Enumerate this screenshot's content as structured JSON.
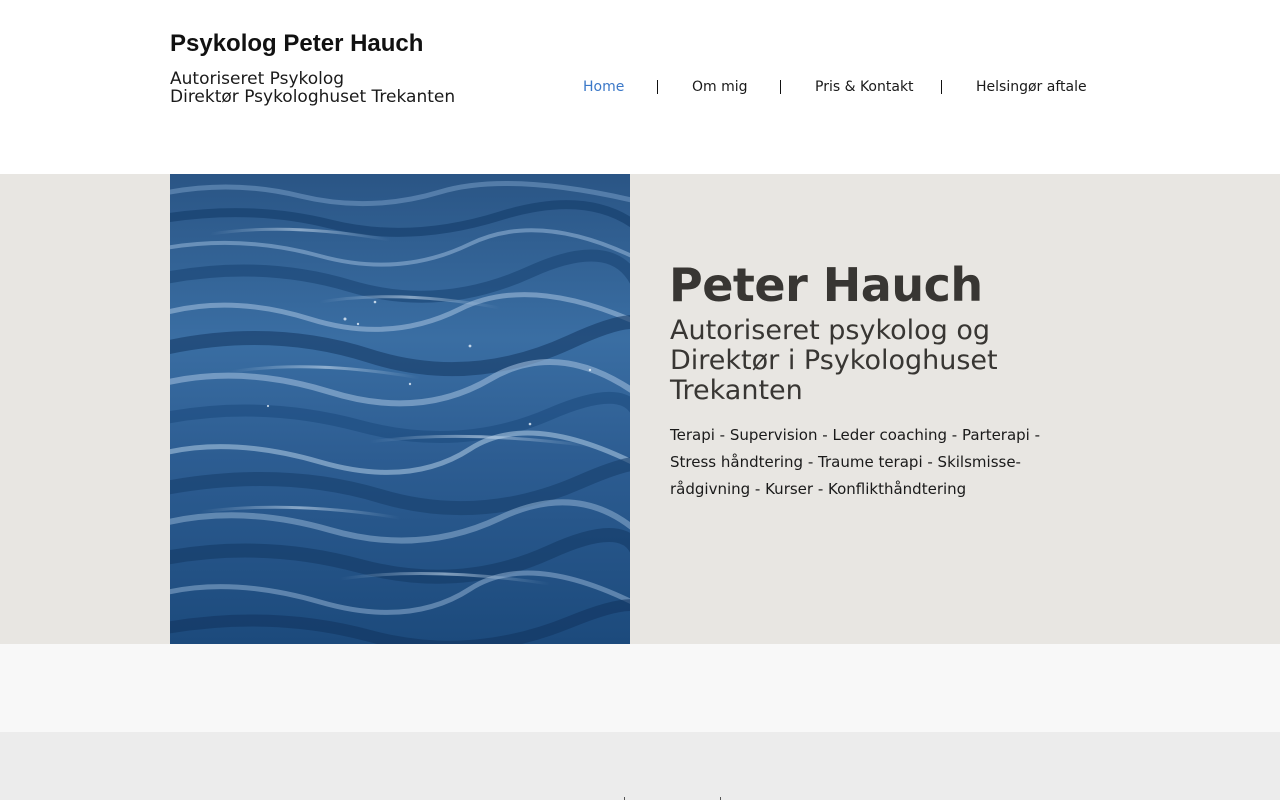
{
  "header": {
    "title": "Psykolog Peter Hauch",
    "subtitle_line1": "Autoriseret Psykolog",
    "subtitle_line2": "Direktør Psykologhuset Trekanten"
  },
  "nav": {
    "items": [
      {
        "label": "Home",
        "active": true
      },
      {
        "label": "Om mig",
        "active": false
      },
      {
        "label": "Pris & Kontakt",
        "active": false
      },
      {
        "label": "Helsingør aftale",
        "active": false
      }
    ],
    "active_color": "#3b78c8"
  },
  "hero": {
    "name": "Peter Hauch",
    "subtitle": "Autoriseret psykolog og Direktør i Psykologhuset Trekanten",
    "services": "Terapi - Supervision - Leder coaching - Parterapi - Stress håndtering - Traume terapi - Skilsmisse-rådgivning - Kurser - Konflikthåndtering",
    "image_subject": "ocean-water-waves",
    "background_color": "#e8e6e2"
  },
  "colors": {
    "text_dark": "#383633",
    "band_light": "#f8f8f8",
    "footer_bg": "#ececec"
  }
}
